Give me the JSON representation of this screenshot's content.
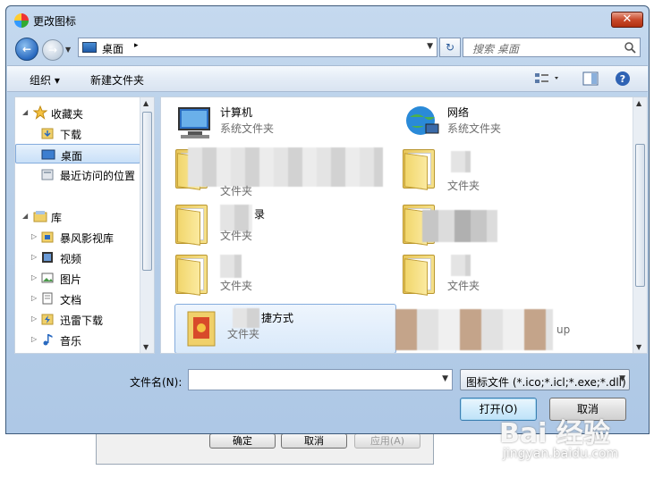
{
  "window": {
    "title": "更改图标",
    "close_label": "✕"
  },
  "address": {
    "location": "桌面",
    "chevron": "▸",
    "dropdown": "▾"
  },
  "search": {
    "placeholder": "搜索 桌面"
  },
  "toolbar": {
    "organize": "组织 ▾",
    "new_folder": "新建文件夹"
  },
  "sidebar": {
    "favorites_label": "收藏夹",
    "favorites": [
      {
        "label": "下载",
        "icon": "download-folder-icon"
      },
      {
        "label": "桌面",
        "icon": "desktop-icon",
        "selected": true
      },
      {
        "label": "最近访问的位置",
        "icon": "recent-places-icon"
      }
    ],
    "libraries_label": "库",
    "libraries": [
      {
        "label": "暴风影视库",
        "icon": "video-library-icon"
      },
      {
        "label": "视频",
        "icon": "video-icon"
      },
      {
        "label": "图片",
        "icon": "picture-icon"
      },
      {
        "label": "文档",
        "icon": "document-icon"
      },
      {
        "label": "迅雷下载",
        "icon": "thunder-download-icon"
      },
      {
        "label": "音乐",
        "icon": "music-icon"
      }
    ]
  },
  "files": [
    {
      "name": "计算机",
      "desc": "系统文件夹",
      "icon": "computer-icon"
    },
    {
      "name": "网络",
      "desc": "系统文件夹",
      "icon": "network-icon"
    },
    {
      "name": "",
      "desc": "文件夹",
      "icon": "folder-icon"
    },
    {
      "name": "",
      "desc": "文件夹",
      "icon": "folder-icon"
    },
    {
      "name": "录",
      "desc": "文件夹",
      "icon": "folder-icon"
    },
    {
      "name": "",
      "desc": "",
      "icon": "folder-icon"
    },
    {
      "name": "",
      "desc": "文件夹",
      "icon": "folder-icon"
    },
    {
      "name": "",
      "desc": "文件夹",
      "icon": "folder-icon"
    },
    {
      "name": "捷方式",
      "desc": "文件夹",
      "icon": "shortcut-folder-icon",
      "selected": true
    },
    {
      "name": "up",
      "desc": "",
      "icon": "app-icon"
    }
  ],
  "bottom": {
    "filename_label": "文件名(N):",
    "filename_value": "",
    "filetype": "图标文件 (*.ico;*.icl;*.exe;*.dll)",
    "open_label": "打开(O)",
    "cancel_label": "取消"
  },
  "background_dialog": {
    "ok": "确定",
    "cancel": "取消",
    "apply": "应用(A)"
  },
  "watermark": {
    "brand": "Bai 经验",
    "url": "jingyan.baidu.com"
  }
}
